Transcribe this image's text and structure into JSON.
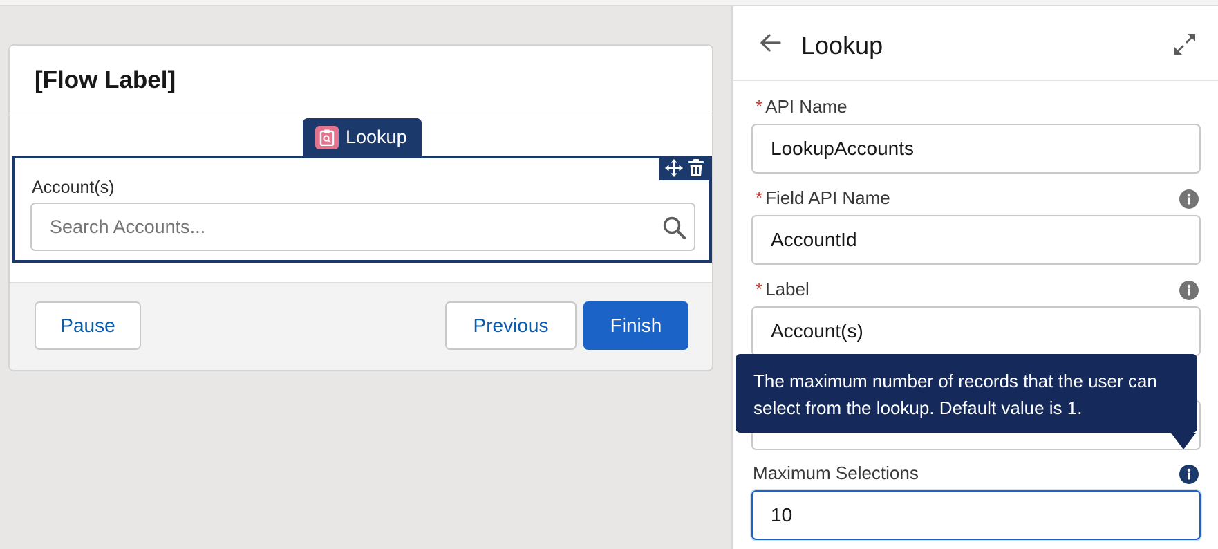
{
  "flow": {
    "title": "[Flow Label]",
    "component_tab_label": "Lookup",
    "field_label": "Account(s)",
    "search_placeholder": "Search Accounts...",
    "buttons": {
      "pause": "Pause",
      "previous": "Previous",
      "finish": "Finish"
    }
  },
  "panel": {
    "title": "Lookup",
    "required_marker": "*",
    "fields": [
      {
        "label": "API Name",
        "value": "LookupAccounts",
        "required": true
      },
      {
        "label": "Field API Name",
        "value": "AccountId",
        "required": true
      },
      {
        "label": "Label",
        "value": "Account(s)",
        "required": true
      },
      {
        "label": "Maximum Selections",
        "value": "10",
        "required": false
      }
    ],
    "tooltip": "The maximum number of records that the user can select from the lookup. Default value is 1."
  },
  "colors": {
    "accent": "#1b3a6b",
    "brand": "#1b63c6",
    "required": "#c23934",
    "tooltip_bg": "#15295a",
    "lookup_icon": "#e4738d"
  }
}
